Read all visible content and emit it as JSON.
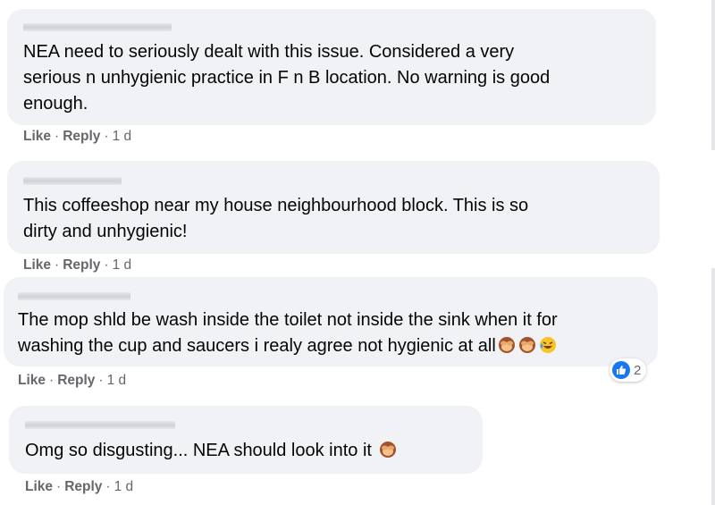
{
  "comments": [
    {
      "lines": [
        "NEA need to seriously dealt with this issue. Considered a very",
        "serious n unhygienic practice in F n B location. No warning is good",
        "enough."
      ],
      "like": "Like",
      "reply": "Reply",
      "time": "1 d"
    },
    {
      "lines": [
        "This coffeeshop near my house neighbourhood block. This is so",
        "dirty and unhygienic!"
      ],
      "like": "Like",
      "reply": "Reply",
      "time": "1 d"
    },
    {
      "lines": [
        "The mop shld be wash inside the toilet not inside the sink when it for",
        "washing the cup and saucers i realy agree not hygienic at all"
      ],
      "emojis": [
        "see-no-evil-monkey-icon",
        "see-no-evil-monkey-icon",
        "laughing-face-icon"
      ],
      "reaction": {
        "icon": "like-reaction-icon",
        "count": "2",
        "color": "#1877f2"
      },
      "like": "Like",
      "reply": "Reply",
      "time": "1 d"
    },
    {
      "lines": [
        "Omg so disgusting... NEA should look into it"
      ],
      "emojis": [
        "see-no-evil-monkey-icon"
      ],
      "like": "Like",
      "reply": "Reply",
      "time": "1 d"
    }
  ],
  "colors": {
    "bubble": "#f0f2f5",
    "text": "#050505",
    "meta": "#65676b",
    "like_reaction": "#1877f2"
  },
  "separator": "·"
}
